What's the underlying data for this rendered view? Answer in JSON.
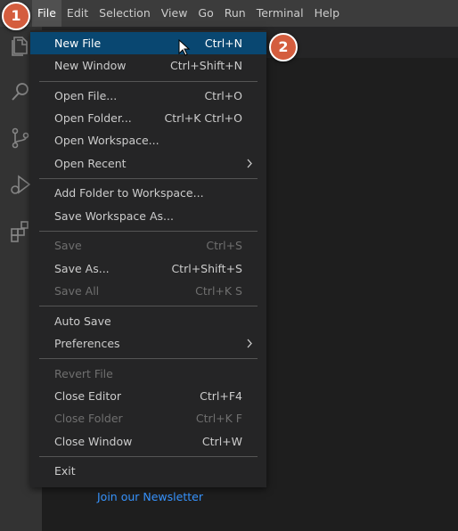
{
  "menubar": {
    "items": [
      "File",
      "Edit",
      "Selection",
      "View",
      "Go",
      "Run",
      "Terminal",
      "Help"
    ]
  },
  "activity_icons": [
    "files-icon",
    "search-icon",
    "source-control-icon",
    "run-debug-icon",
    "extensions-icon"
  ],
  "file_menu": {
    "new_file": {
      "label": "New File",
      "shortcut": "Ctrl+N"
    },
    "new_window": {
      "label": "New Window",
      "shortcut": "Ctrl+Shift+N"
    },
    "open_file": {
      "label": "Open File...",
      "shortcut": "Ctrl+O"
    },
    "open_folder": {
      "label": "Open Folder...",
      "shortcut": "Ctrl+K Ctrl+O"
    },
    "open_workspace": {
      "label": "Open Workspace..."
    },
    "open_recent": {
      "label": "Open Recent"
    },
    "add_folder": {
      "label": "Add Folder to Workspace..."
    },
    "save_workspace_as": {
      "label": "Save Workspace As..."
    },
    "save": {
      "label": "Save",
      "shortcut": "Ctrl+S"
    },
    "save_as": {
      "label": "Save As...",
      "shortcut": "Ctrl+Shift+S"
    },
    "save_all": {
      "label": "Save All",
      "shortcut": "Ctrl+K S"
    },
    "auto_save": {
      "label": "Auto Save"
    },
    "preferences": {
      "label": "Preferences"
    },
    "revert_file": {
      "label": "Revert File"
    },
    "close_editor": {
      "label": "Close Editor",
      "shortcut": "Ctrl+F4"
    },
    "close_folder": {
      "label": "Close Folder",
      "shortcut": "Ctrl+K F"
    },
    "close_window": {
      "label": "Close Window",
      "shortcut": "Ctrl+W"
    },
    "exit": {
      "label": "Exit"
    }
  },
  "editor": {
    "newsletter_link": "Join our Newsletter"
  },
  "badges": {
    "step1": "1",
    "step2": "2"
  },
  "colors": {
    "menubar_bg": "#3c3c3c",
    "menu_bg": "#252526",
    "highlight": "#094771",
    "badge": "#d45d3e",
    "link": "#3794ff"
  }
}
